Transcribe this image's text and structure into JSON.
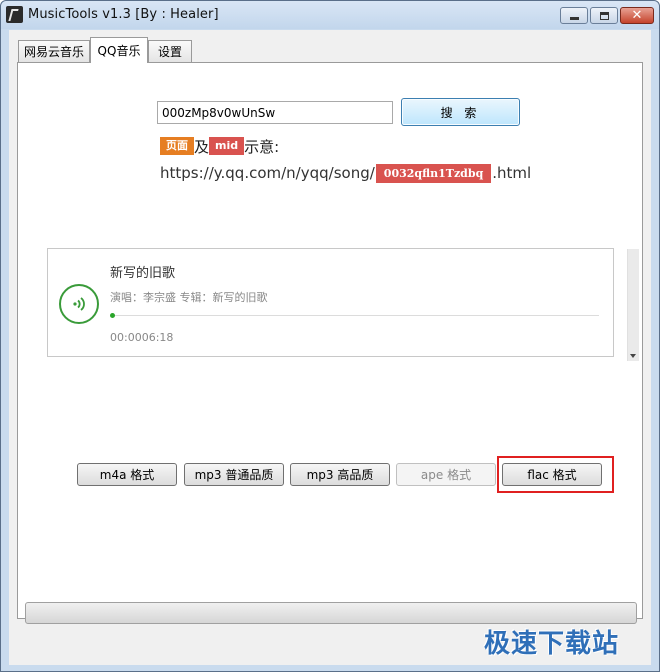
{
  "window": {
    "title": "MusicTools v1.3 [By : Healer]",
    "controls": {
      "minimize": "–",
      "maximize": "□",
      "close": "✕"
    }
  },
  "tabs": [
    {
      "label": "网易云音乐",
      "active": false
    },
    {
      "label": "QQ音乐",
      "active": true
    },
    {
      "label": "设置",
      "active": false
    }
  ],
  "search": {
    "value": "000zMp8v0wUnSw",
    "button_label": "搜 索"
  },
  "hint": {
    "page_tag": "页面",
    "and_text": "及",
    "mid_tag": "mid",
    "suffix": "示意:",
    "url_prefix": "https://y.qq.com/n/yqq/song/",
    "url_mid": "0032qfln1Tzdbq",
    "url_suffix": ".html"
  },
  "song": {
    "title": "新写的旧歌",
    "meta": "演唱：李宗盛 专辑：新写的旧歌",
    "time": "00:0006:18",
    "progress": 0
  },
  "formats": {
    "m4a": "m4a 格式",
    "mp3_normal": "mp3 普通品质",
    "mp3_high": "mp3 高品质",
    "ape": "ape 格式",
    "flac": "flac 格式"
  },
  "colors": {
    "accent_green": "#3a9b3a",
    "tag_orange": "#e67e22",
    "tag_red": "#d9534f",
    "highlight_red": "#e02020"
  },
  "watermark": "极速下载站"
}
